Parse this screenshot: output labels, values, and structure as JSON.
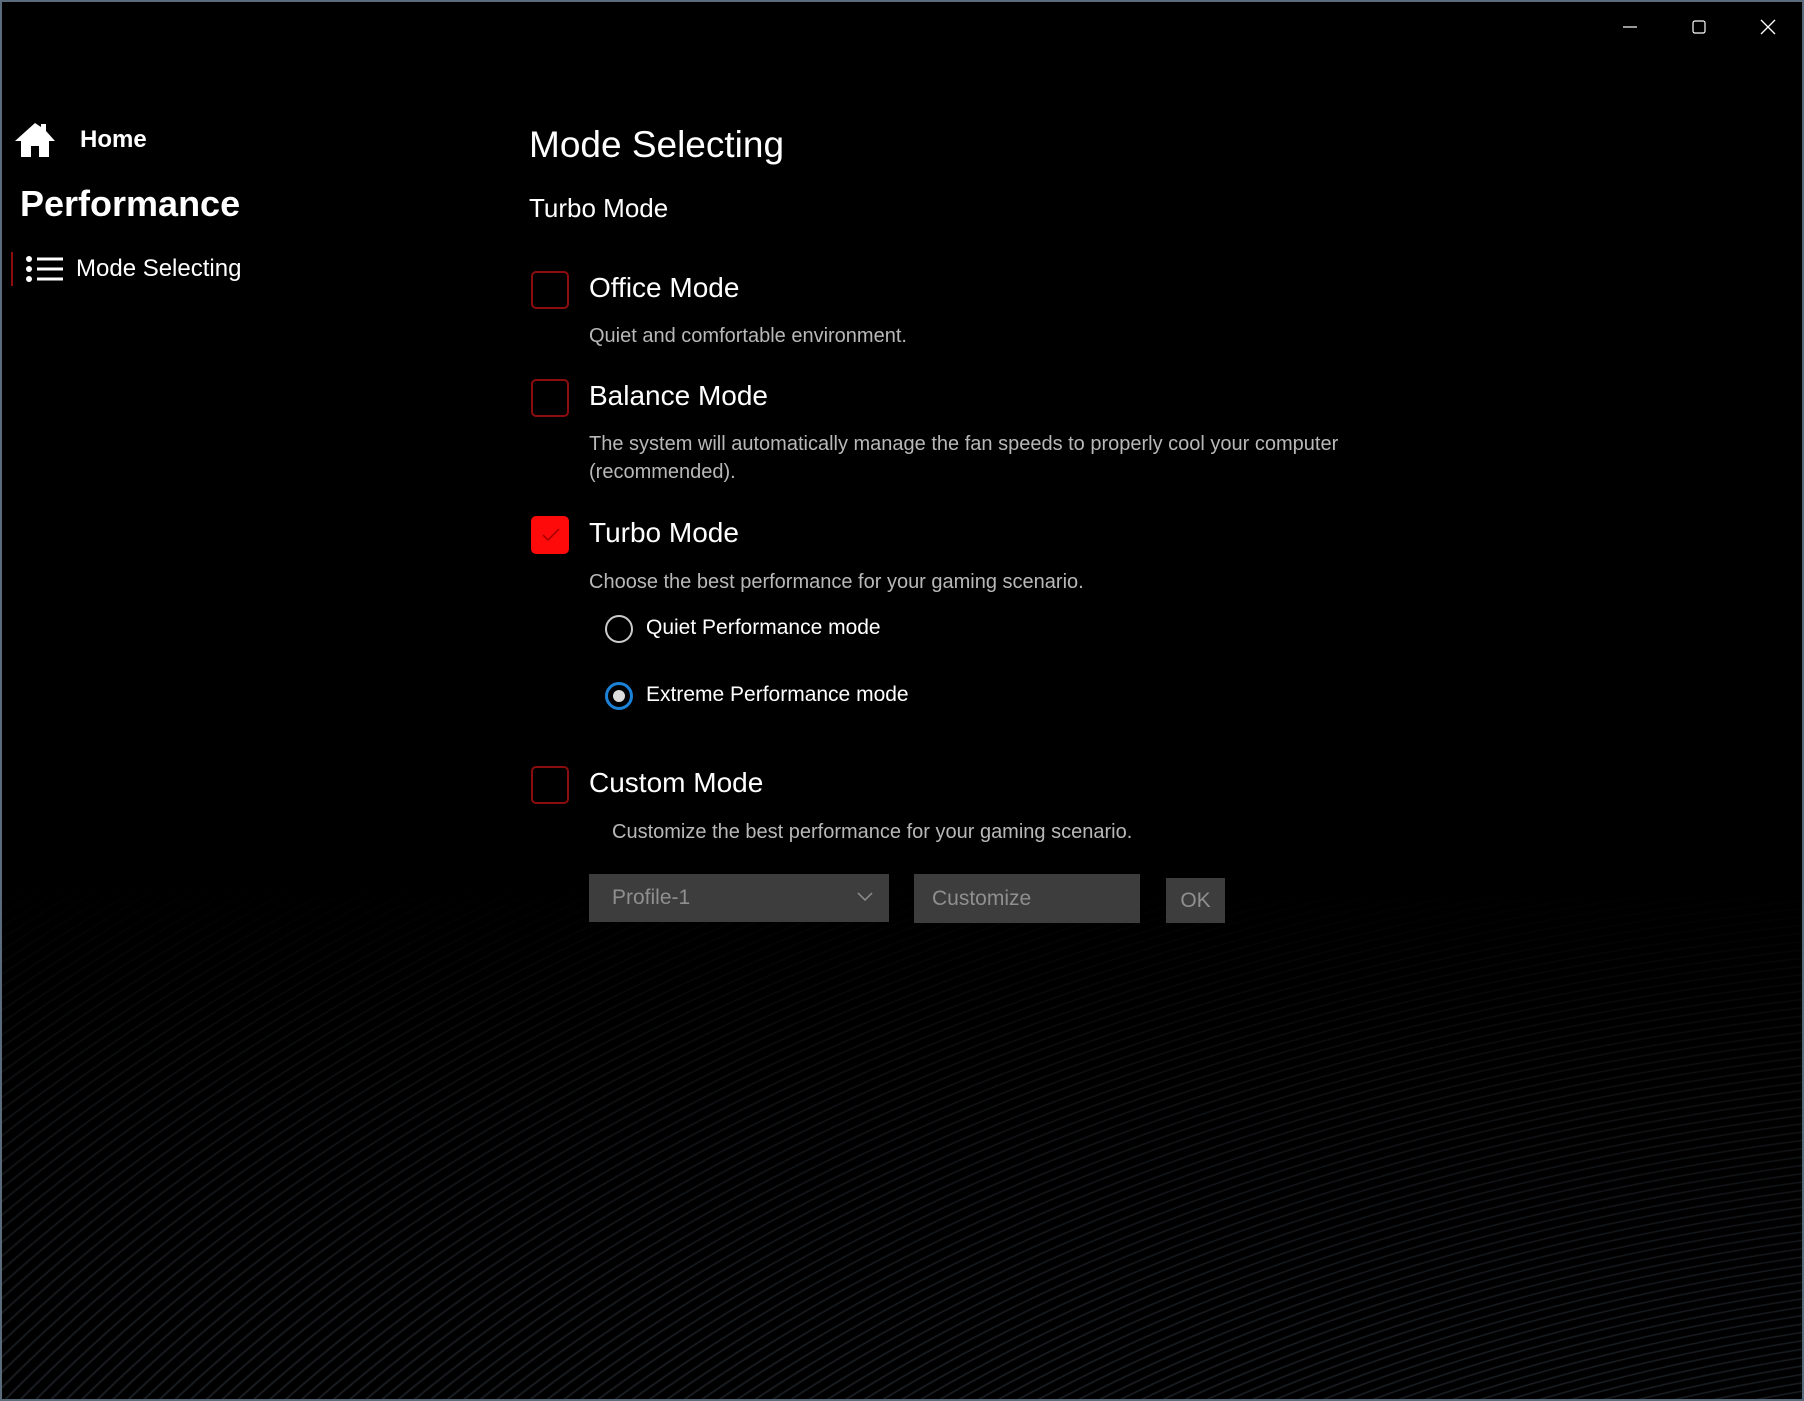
{
  "window": {
    "minimize_icon": "minimize-icon",
    "maximize_icon": "maximize-icon",
    "close_icon": "close-icon"
  },
  "sidebar": {
    "home_label": "Home",
    "section_title": "Performance",
    "items": [
      {
        "label": "Mode Selecting",
        "icon": "list-icon"
      }
    ]
  },
  "main": {
    "title": "Mode Selecting",
    "current_mode": "Turbo Mode",
    "modes": [
      {
        "title": "Office Mode",
        "description": "Quiet and comfortable environment.",
        "checked": false
      },
      {
        "title": "Balance Mode",
        "description": "The system will automatically manage the fan speeds to properly cool your computer (recommended).",
        "checked": false
      },
      {
        "title": "Turbo Mode",
        "description": "Choose the best performance for your gaming scenario.",
        "checked": true
      },
      {
        "title": "Custom Mode",
        "description": "Customize the best performance for your gaming scenario.",
        "checked": false
      }
    ],
    "turbo_options": [
      {
        "label": "Quiet Performance mode",
        "selected": false
      },
      {
        "label": "Extreme Performance mode",
        "selected": true
      }
    ],
    "custom": {
      "profile_value": "Profile-1",
      "customize_placeholder": "Customize",
      "ok_label": "OK"
    }
  },
  "colors": {
    "accent_red": "#ff0a0a",
    "radio_blue": "#1b82d8"
  }
}
